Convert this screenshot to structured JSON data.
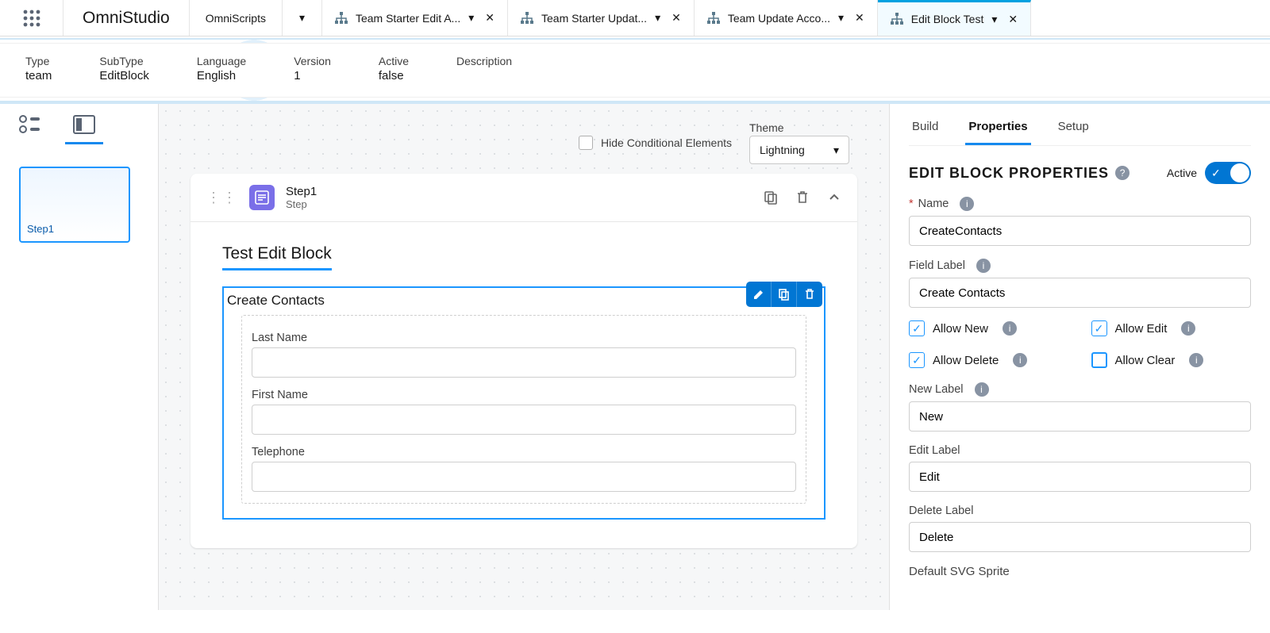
{
  "app": {
    "title": "OmniStudio"
  },
  "nav_item": {
    "label": "OmniScripts"
  },
  "tabs": [
    {
      "label": "Team Starter Edit A...",
      "active": false
    },
    {
      "label": "Team Starter Updat...",
      "active": false
    },
    {
      "label": "Team Update Acco...",
      "active": false
    },
    {
      "label": "Edit Block Test",
      "active": true
    }
  ],
  "ribbon": {
    "type_label": "Type",
    "type_value": "team",
    "subtype_label": "SubType",
    "subtype_value": "EditBlock",
    "language_label": "Language",
    "language_value": "English",
    "version_label": "Version",
    "version_value": "1",
    "active_label": "Active",
    "active_value": "false",
    "description_label": "Description",
    "description_value": ""
  },
  "canvas": {
    "hide_conditional_label": "Hide Conditional Elements",
    "theme_label": "Theme",
    "theme_value": "Lightning",
    "step_thumb_label": "Step1",
    "step": {
      "name": "Step1",
      "type": "Step"
    },
    "section_title": "Test Edit Block",
    "edit_block_title": "Create Contacts",
    "fields": [
      {
        "label": "Last Name",
        "value": ""
      },
      {
        "label": "First Name",
        "value": ""
      },
      {
        "label": "Telephone",
        "value": ""
      }
    ]
  },
  "panel": {
    "tabs": {
      "build": "Build",
      "properties": "Properties",
      "setup": "Setup"
    },
    "title": "EDIT BLOCK PROPERTIES",
    "active_label": "Active",
    "name_label": "Name",
    "name_value": "CreateContacts",
    "field_label_lbl": "Field Label",
    "field_label_value": "Create Contacts",
    "allow_new_label": "Allow New",
    "allow_edit_label": "Allow Edit",
    "allow_delete_label": "Allow Delete",
    "allow_clear_label": "Allow Clear",
    "new_label_lbl": "New Label",
    "new_label_value": "New",
    "edit_label_lbl": "Edit Label",
    "edit_label_value": "Edit",
    "delete_label_lbl": "Delete Label",
    "delete_label_value": "Delete",
    "default_svg_label": "Default SVG Sprite"
  }
}
